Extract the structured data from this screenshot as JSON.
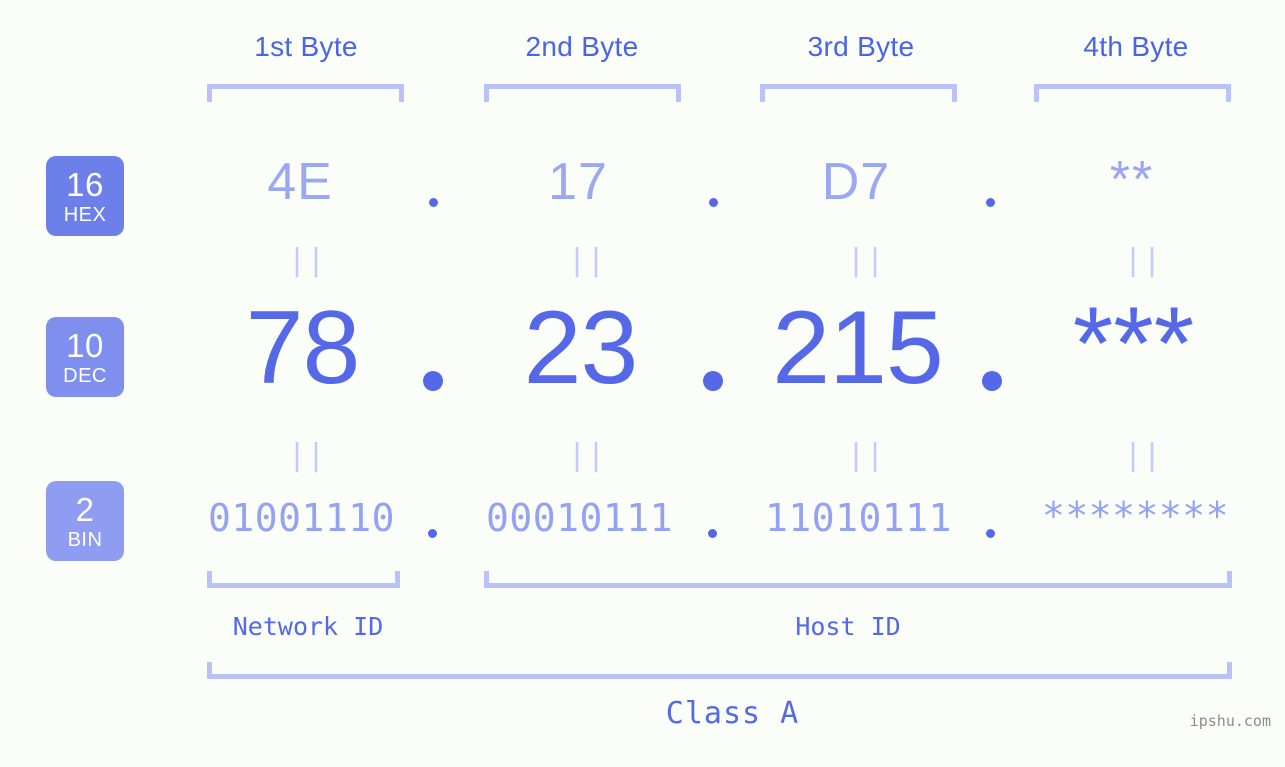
{
  "meta": {
    "background_color": "#fbfdf8",
    "accent_color": "#5569e8",
    "light_accent_color": "#9aa8f3",
    "bracket_color": "#b9c3f9",
    "watermark": "ipshu.com"
  },
  "columns": [
    {
      "header": "1st Byte"
    },
    {
      "header": "2nd Byte"
    },
    {
      "header": "3rd Byte"
    },
    {
      "header": "4th Byte"
    }
  ],
  "bases": [
    {
      "number": "16",
      "name": "HEX",
      "color": "#6d80ea"
    },
    {
      "number": "10",
      "name": "DEC",
      "color": "#7e8fee"
    },
    {
      "number": "2",
      "name": "BIN",
      "color": "#8e9df2"
    }
  ],
  "rows": {
    "hex": {
      "values": [
        "4E",
        "17",
        "D7",
        "**"
      ]
    },
    "dec": {
      "values": [
        "78",
        "23",
        "215",
        "***"
      ]
    },
    "bin": {
      "values": [
        "01001110",
        "00010111",
        "11010111",
        "********"
      ]
    }
  },
  "separators": {
    "dot": ".",
    "equality": "||"
  },
  "segments": {
    "network_id": "Network ID",
    "host_id": "Host ID"
  },
  "class_label": "Class A"
}
